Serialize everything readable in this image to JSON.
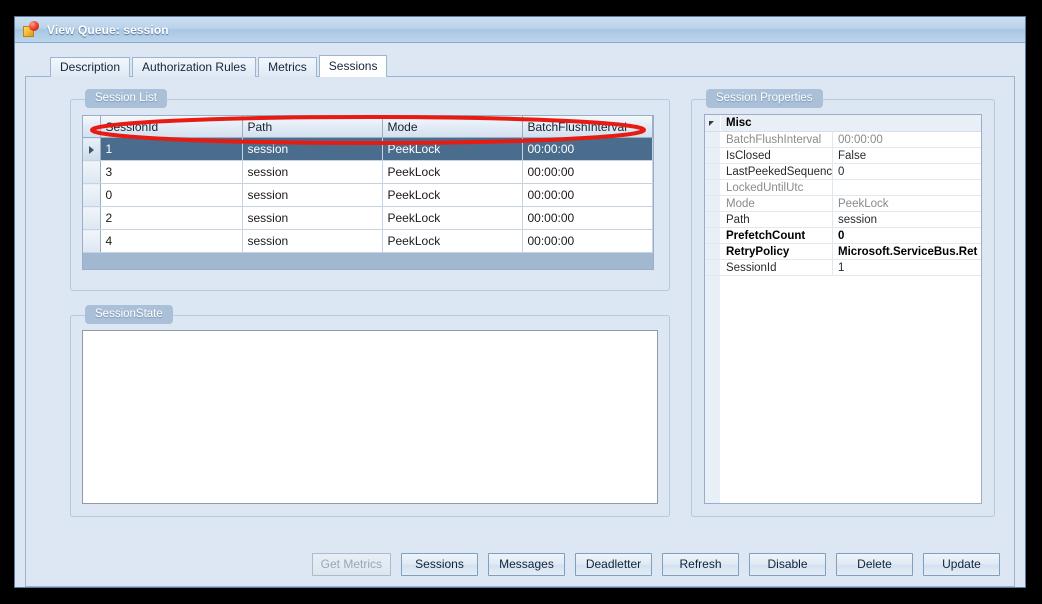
{
  "window": {
    "title": "View Queue: session",
    "icon": "queue-cube-icon"
  },
  "tabs": [
    {
      "label": "Description",
      "active": false
    },
    {
      "label": "Authorization Rules",
      "active": false
    },
    {
      "label": "Metrics",
      "active": false
    },
    {
      "label": "Sessions",
      "active": true
    }
  ],
  "session_list": {
    "group_label": "Session List",
    "columns": [
      "SessionId",
      "Path",
      "Mode",
      "BatchFlushInterval"
    ],
    "rows": [
      {
        "selected": true,
        "marker": "▶",
        "SessionId": "1",
        "Path": "session",
        "Mode": "PeekLock",
        "BatchFlushInterval": "00:00:00"
      },
      {
        "selected": false,
        "marker": "",
        "SessionId": "3",
        "Path": "session",
        "Mode": "PeekLock",
        "BatchFlushInterval": "00:00:00"
      },
      {
        "selected": false,
        "marker": "",
        "SessionId": "0",
        "Path": "session",
        "Mode": "PeekLock",
        "BatchFlushInterval": "00:00:00"
      },
      {
        "selected": false,
        "marker": "",
        "SessionId": "2",
        "Path": "session",
        "Mode": "PeekLock",
        "BatchFlushInterval": "00:00:00"
      },
      {
        "selected": false,
        "marker": "",
        "SessionId": "4",
        "Path": "session",
        "Mode": "PeekLock",
        "BatchFlushInterval": "00:00:00"
      }
    ],
    "annotation": {
      "shape": "ellipse",
      "color": "#e81b13",
      "target": "column-headers"
    }
  },
  "session_state": {
    "group_label": "SessionState",
    "value": "",
    "placeholder": ""
  },
  "session_properties": {
    "group_label": "Session Properties",
    "category": "Misc",
    "rows": [
      {
        "name": "BatchFlushInterval",
        "value": "00:00:00",
        "style": "dim"
      },
      {
        "name": "IsClosed",
        "value": "False",
        "style": "normal"
      },
      {
        "name": "LastPeekedSequence",
        "value": "0",
        "style": "normal"
      },
      {
        "name": "LockedUntilUtc",
        "value": "",
        "style": "dim"
      },
      {
        "name": "Mode",
        "value": "PeekLock",
        "style": "dim"
      },
      {
        "name": "Path",
        "value": "session",
        "style": "normal"
      },
      {
        "name": "PrefetchCount",
        "value": "0",
        "style": "bold"
      },
      {
        "name": "RetryPolicy",
        "value": "Microsoft.ServiceBus.Ret",
        "style": "bold"
      },
      {
        "name": "SessionId",
        "value": "1",
        "style": "normal"
      }
    ]
  },
  "buttons": [
    {
      "label": "Get Metrics",
      "disabled": true
    },
    {
      "label": "Sessions",
      "disabled": false
    },
    {
      "label": "Messages",
      "disabled": false
    },
    {
      "label": "Deadletter",
      "disabled": false
    },
    {
      "label": "Refresh",
      "disabled": false
    },
    {
      "label": "Disable",
      "disabled": false
    },
    {
      "label": "Delete",
      "disabled": false
    },
    {
      "label": "Update",
      "disabled": false
    }
  ],
  "colors": {
    "window_bg": "#dce7f3",
    "titlebar": "#b9d2ea",
    "group_label_bg": "#a9c0d8",
    "selection": "#4a6c8d",
    "grid_filler": "#a2b8d0",
    "annotation_red": "#e81b13",
    "border": "#9db4cd"
  }
}
